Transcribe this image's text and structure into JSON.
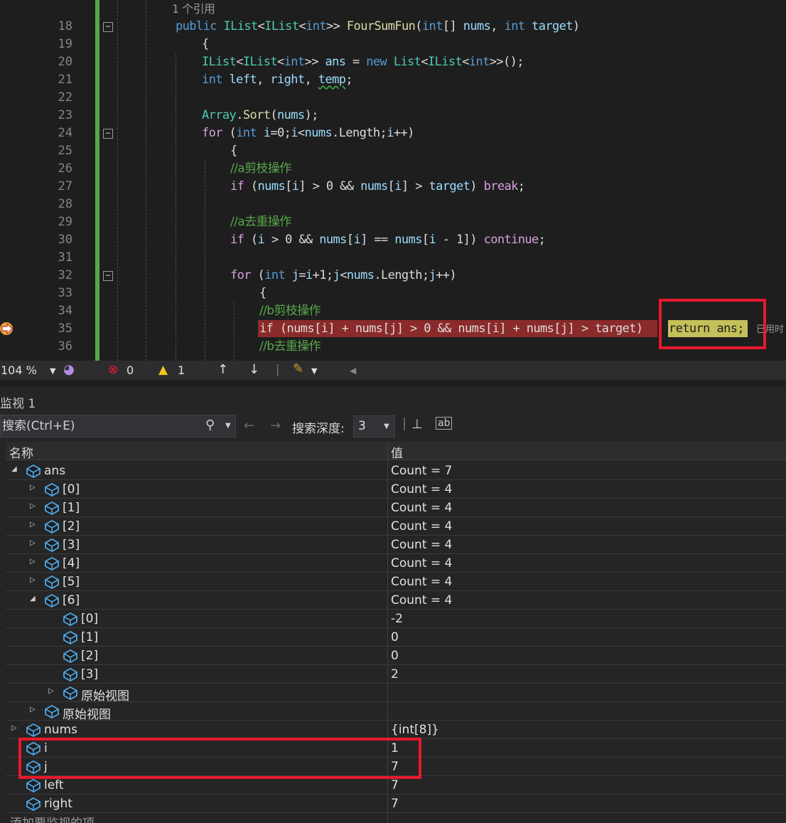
{
  "editor": {
    "codelens": "1 个引用",
    "lines": [
      {
        "n": "18",
        "segs": [
          [
            "kw",
            "public "
          ],
          [
            "ty",
            "IList"
          ],
          [
            "",
            "<"
          ],
          [
            "ty",
            "IList"
          ],
          [
            "",
            "<"
          ],
          [
            "kw",
            "int"
          ],
          [
            "",
            ">> "
          ],
          [
            "fn",
            "FourSumFun"
          ],
          [
            "",
            "("
          ],
          [
            "kw",
            "int"
          ],
          [
            "",
            "[] "
          ],
          [
            "pa",
            "nums"
          ],
          [
            "",
            ", "
          ],
          [
            "kw",
            "int"
          ],
          [
            "pa",
            " target"
          ],
          [
            "",
            ")"
          ]
        ]
      },
      {
        "n": "19",
        "segs": [
          [
            "",
            "{"
          ]
        ]
      },
      {
        "n": "20",
        "segs": [
          [
            "ty",
            "IList"
          ],
          [
            "",
            "<"
          ],
          [
            "ty",
            "IList"
          ],
          [
            "",
            "<"
          ],
          [
            "kw",
            "int"
          ],
          [
            "",
            ">> "
          ],
          [
            "pa",
            "ans"
          ],
          [
            "",
            " = "
          ],
          [
            "kw",
            "new "
          ],
          [
            "ty",
            "List"
          ],
          [
            "",
            "<"
          ],
          [
            "ty",
            "IList"
          ],
          [
            "",
            "<"
          ],
          [
            "kw",
            "int"
          ],
          [
            "",
            ">>();"
          ]
        ]
      },
      {
        "n": "21",
        "segs": [
          [
            "kw",
            "int "
          ],
          [
            "pa",
            "left"
          ],
          [
            "",
            ", "
          ],
          [
            "pa",
            "right"
          ],
          [
            "",
            ", "
          ],
          [
            "pa squig",
            "temp"
          ],
          [
            "",
            ";"
          ]
        ]
      },
      {
        "n": "22",
        "segs": []
      },
      {
        "n": "23",
        "segs": [
          [
            "ty",
            "Array"
          ],
          [
            "",
            "."
          ],
          [
            "fn",
            "Sort"
          ],
          [
            "",
            "("
          ],
          [
            "pa",
            "nums"
          ],
          [
            "",
            ");"
          ]
        ]
      },
      {
        "n": "24",
        "segs": [
          [
            "ctl",
            "for "
          ],
          [
            "",
            "("
          ],
          [
            "kw",
            "int "
          ],
          [
            "pa",
            "i"
          ],
          [
            "",
            "=0;"
          ],
          [
            "pa",
            "i"
          ],
          [
            "",
            "<"
          ],
          [
            "pa",
            "nums"
          ],
          [
            "",
            ".Length;"
          ],
          [
            "pa",
            "i"
          ],
          [
            "",
            "++)"
          ]
        ]
      },
      {
        "n": "25",
        "segs": [
          [
            "",
            "{"
          ]
        ]
      },
      {
        "n": "26",
        "segs": [
          [
            "cm",
            "//a剪枝操作"
          ]
        ]
      },
      {
        "n": "27",
        "segs": [
          [
            "ctl",
            "if "
          ],
          [
            "",
            "("
          ],
          [
            "pa",
            "nums"
          ],
          [
            "",
            "["
          ],
          [
            "pa",
            "i"
          ],
          [
            "",
            "] > 0 && "
          ],
          [
            "pa",
            "nums"
          ],
          [
            "",
            "["
          ],
          [
            "pa",
            "i"
          ],
          [
            "",
            "] > "
          ],
          [
            "pa",
            "target"
          ],
          [
            "",
            ") "
          ],
          [
            "ctl",
            "break"
          ],
          [
            "",
            ";"
          ]
        ]
      },
      {
        "n": "28",
        "segs": []
      },
      {
        "n": "29",
        "segs": [
          [
            "cm",
            "//a去重操作"
          ]
        ]
      },
      {
        "n": "30",
        "segs": [
          [
            "ctl",
            "if "
          ],
          [
            "",
            "("
          ],
          [
            "pa",
            "i"
          ],
          [
            "",
            " > 0 && "
          ],
          [
            "pa",
            "nums"
          ],
          [
            "",
            "["
          ],
          [
            "pa",
            "i"
          ],
          [
            "",
            "] == "
          ],
          [
            "pa",
            "nums"
          ],
          [
            "",
            "["
          ],
          [
            "pa",
            "i"
          ],
          [
            "",
            " - 1]) "
          ],
          [
            "ctl",
            "continue"
          ],
          [
            "",
            ";"
          ]
        ]
      },
      {
        "n": "31",
        "segs": []
      },
      {
        "n": "32",
        "segs": [
          [
            "ctl",
            "for "
          ],
          [
            "",
            "("
          ],
          [
            "kw",
            "int "
          ],
          [
            "pa",
            "j"
          ],
          [
            "",
            "="
          ],
          [
            "pa",
            "i"
          ],
          [
            "",
            "+1;"
          ],
          [
            "pa",
            "j"
          ],
          [
            "",
            "<"
          ],
          [
            "pa",
            "nums"
          ],
          [
            "",
            ".Length;"
          ],
          [
            "pa",
            "j"
          ],
          [
            "",
            "++)"
          ]
        ]
      },
      {
        "n": "33",
        "segs": [
          [
            "",
            "{"
          ]
        ]
      },
      {
        "n": "34",
        "segs": [
          [
            "cm",
            "//b剪枝操作"
          ]
        ]
      },
      {
        "n": "35",
        "segs": [
          [
            "",
            "if (nums[i] + nums[j] > 0 && nums[i] + nums[j] > target) "
          ]
        ]
      },
      {
        "n": "36",
        "segs": [
          [
            "cm",
            "//b去重操作"
          ]
        ]
      }
    ],
    "return_stmt": "return ans;",
    "trailing_hint": "已用时"
  },
  "statusbar": {
    "zoom": "104 %",
    "errors": "0",
    "warnings": "1"
  },
  "watch": {
    "title": "监视 1",
    "search_placeholder": "搜索(Ctrl+E)",
    "depth_label": "搜索深度:",
    "depth_value": "3",
    "col_name": "名称",
    "col_value": "值",
    "rows": [
      {
        "name": "ans",
        "value": "Count = 7",
        "indent": 0,
        "tw": "open"
      },
      {
        "name": "[0]",
        "value": "Count = 4",
        "indent": 1,
        "tw": "closed"
      },
      {
        "name": "[1]",
        "value": "Count = 4",
        "indent": 1,
        "tw": "closed"
      },
      {
        "name": "[2]",
        "value": "Count = 4",
        "indent": 1,
        "tw": "closed"
      },
      {
        "name": "[3]",
        "value": "Count = 4",
        "indent": 1,
        "tw": "closed"
      },
      {
        "name": "[4]",
        "value": "Count = 4",
        "indent": 1,
        "tw": "closed"
      },
      {
        "name": "[5]",
        "value": "Count = 4",
        "indent": 1,
        "tw": "closed"
      },
      {
        "name": "[6]",
        "value": "Count = 4",
        "indent": 1,
        "tw": "open"
      },
      {
        "name": "[0]",
        "value": "-2",
        "indent": 2,
        "tw": "none"
      },
      {
        "name": "[1]",
        "value": "0",
        "indent": 2,
        "tw": "none"
      },
      {
        "name": "[2]",
        "value": "0",
        "indent": 2,
        "tw": "none"
      },
      {
        "name": "[3]",
        "value": "2",
        "indent": 2,
        "tw": "none"
      },
      {
        "name": "原始视图",
        "value": "",
        "indent": 2,
        "tw": "closed"
      },
      {
        "name": "原始视图",
        "value": "",
        "indent": 1,
        "tw": "closed"
      },
      {
        "name": "nums",
        "value": "{int[8]}",
        "indent": 0,
        "tw": "closed"
      },
      {
        "name": "i",
        "value": "1",
        "indent": 0,
        "tw": "none"
      },
      {
        "name": "j",
        "value": "7",
        "indent": 0,
        "tw": "none"
      },
      {
        "name": "left",
        "value": "7",
        "indent": 0,
        "tw": "none"
      },
      {
        "name": "right",
        "value": "7",
        "indent": 0,
        "tw": "none"
      }
    ],
    "add_item": "添加要监视的项"
  }
}
